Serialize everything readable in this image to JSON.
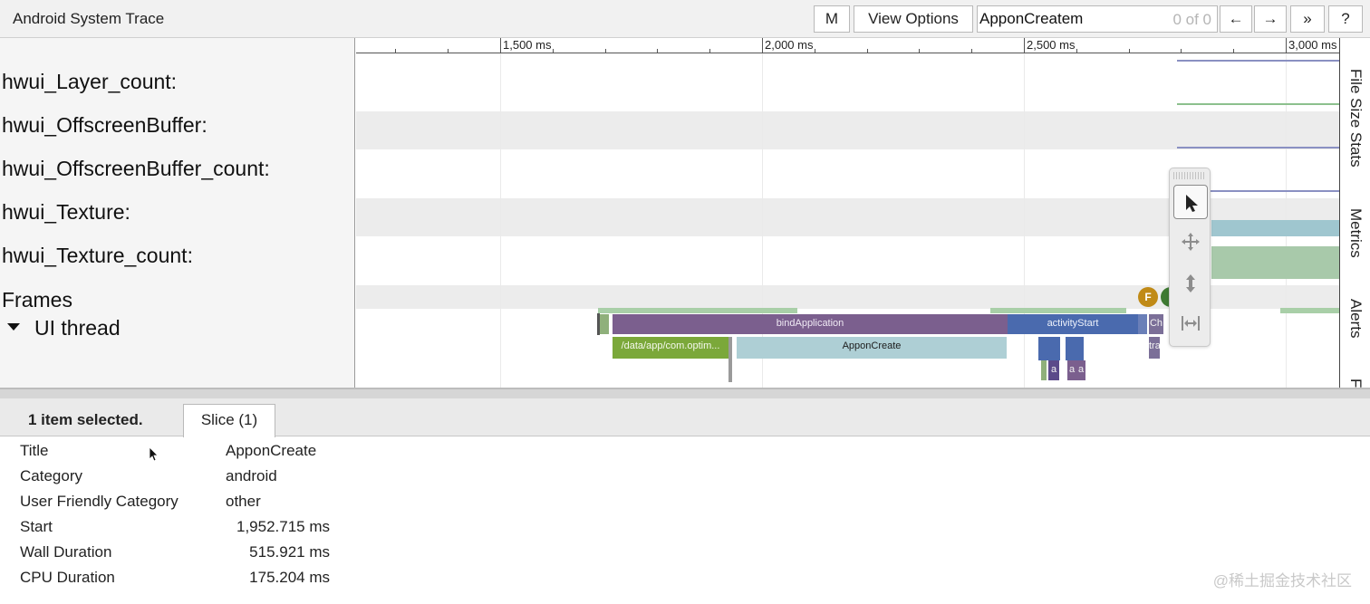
{
  "topbar": {
    "title": "Android System Trace",
    "m_label": "M",
    "view_options_label": "View Options",
    "search_value": "ApponCreatem",
    "search_count": "0 of 0",
    "prev_label": "←",
    "next_label": "→",
    "more_label": "»",
    "help_label": "?"
  },
  "ruler": {
    "ticks": [
      "1,500 ms",
      "2,000 ms",
      "2,500 ms",
      "3,000 ms"
    ]
  },
  "tracks": {
    "labels": [
      "hwui_Layer_count:",
      "hwui_OffscreenBuffer:",
      "hwui_OffscreenBuffer_count:",
      "hwui_Texture:",
      "hwui_Texture_count:",
      "Frames"
    ],
    "ui_thread": "UI thread"
  },
  "slices": {
    "bind_application": "bindApplication",
    "activity_start": "activityStart",
    "data_app": "/data/app/com.optim...",
    "appon_create": "ApponCreate",
    "ch": "Ch",
    "tra": "tra",
    "a1": "a",
    "a2": "a",
    "a3": "a"
  },
  "markers": {
    "frame_marker": "F"
  },
  "side_tabs": [
    "File Size Stats",
    "Metrics",
    "Alerts",
    "F"
  ],
  "palette": {
    "tools": [
      "selection-icon",
      "pan-icon",
      "zoom-icon",
      "timing-icon"
    ]
  },
  "colors": {
    "bind_application": "#7b5f8e",
    "activity_start": "#4a6aae",
    "data_app": "#7ba83a",
    "appon_create": "#aecfd5",
    "frame_marker": "#c08a17",
    "counter_blue": "#8a90c2",
    "counter_green": "#8cc08d",
    "texture_teal": "#9fc6cf",
    "texture_green": "#a8c9aa"
  },
  "bottom": {
    "selection": "1 item selected.",
    "tab": "Slice (1)"
  },
  "details": {
    "rows": [
      {
        "key": "Title",
        "value": "ApponCreate"
      },
      {
        "key": "Category",
        "value": "android"
      },
      {
        "key": "User Friendly Category",
        "value": "other"
      },
      {
        "key": "Start",
        "value": "1,952.715 ms"
      },
      {
        "key": "Wall Duration",
        "value": "515.921 ms"
      },
      {
        "key": "CPU Duration",
        "value": "175.204 ms"
      }
    ]
  },
  "watermark": "@稀土掘金技术社区"
}
